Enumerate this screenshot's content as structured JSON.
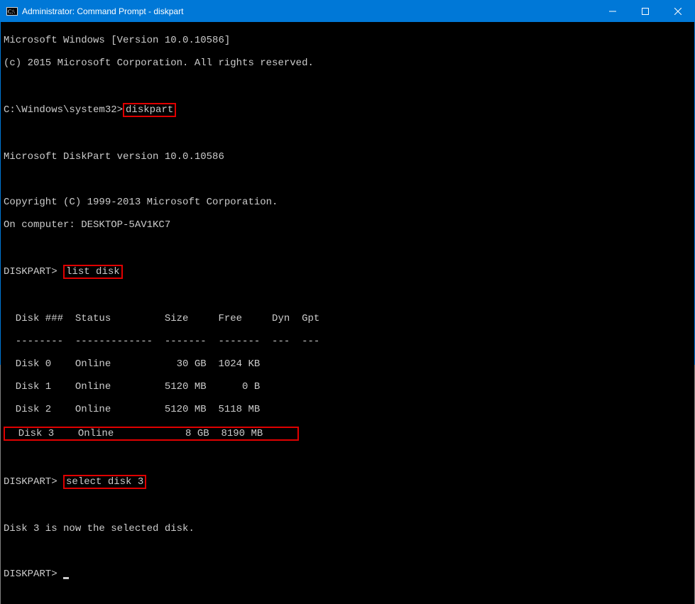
{
  "titlebar": {
    "title": "Administrator: Command Prompt - diskpart"
  },
  "terminal": {
    "win_version": "Microsoft Windows [Version 10.0.10586]",
    "copyright1": "(c) 2015 Microsoft Corporation. All rights reserved.",
    "prompt1_path": "C:\\Windows\\system32>",
    "cmd1": "diskpart",
    "dp_version": "Microsoft DiskPart version 10.0.10586",
    "dp_copyright": "Copyright (C) 1999-2013 Microsoft Corporation.",
    "dp_computer": "On computer: DESKTOP-5AV1KC7",
    "dp_prompt": "DISKPART>",
    "cmd2": "list disk",
    "table": {
      "header": "  Disk ###  Status         Size     Free     Dyn  Gpt",
      "divider": "  --------  -------------  -------  -------  ---  ---",
      "rows": [
        "  Disk 0    Online           30 GB  1024 KB",
        "  Disk 1    Online         5120 MB      0 B",
        "  Disk 2    Online         5120 MB  5118 MB",
        "  Disk 3    Online            8 GB  8190 MB"
      ]
    },
    "cmd3": "select disk 3",
    "result": "Disk 3 is now the selected disk.",
    "final_prompt": "DISKPART> "
  }
}
